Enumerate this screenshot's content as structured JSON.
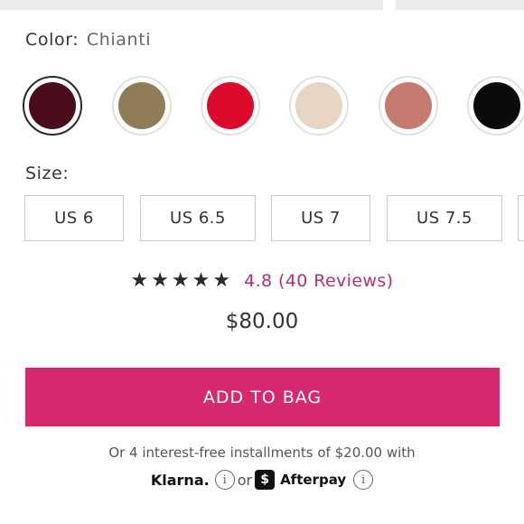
{
  "color": {
    "label": "Color:",
    "selected": "Chianti",
    "swatches": [
      {
        "name": "chianti",
        "hex": "#4a0d1c",
        "selected": true
      },
      {
        "name": "gold-glitter",
        "hex": "#8e7d56",
        "selected": false
      },
      {
        "name": "red",
        "hex": "#dc0a2b",
        "selected": false
      },
      {
        "name": "nude",
        "hex": "#e6d6c3",
        "selected": false
      },
      {
        "name": "rose-gold",
        "hex": "#c67b70",
        "selected": false
      },
      {
        "name": "black",
        "hex": "#0b0b0b",
        "selected": false
      }
    ]
  },
  "size": {
    "label": "Size:",
    "options": [
      "US 6",
      "US 6.5",
      "US 7",
      "US 7.5"
    ]
  },
  "rating": {
    "stars": "★★★★★",
    "value_text": "4.8 (40 Reviews)"
  },
  "price": "$80.00",
  "cta": {
    "add_to_bag": "ADD TO BAG",
    "accent": "#d6296f"
  },
  "installments": {
    "text": "Or 4 interest-free installments of $20.00 with",
    "klarna": "Klarna.",
    "or": "or",
    "afterpay": "Afterpay",
    "afterpay_badge": "$",
    "info_symbol": "i"
  }
}
